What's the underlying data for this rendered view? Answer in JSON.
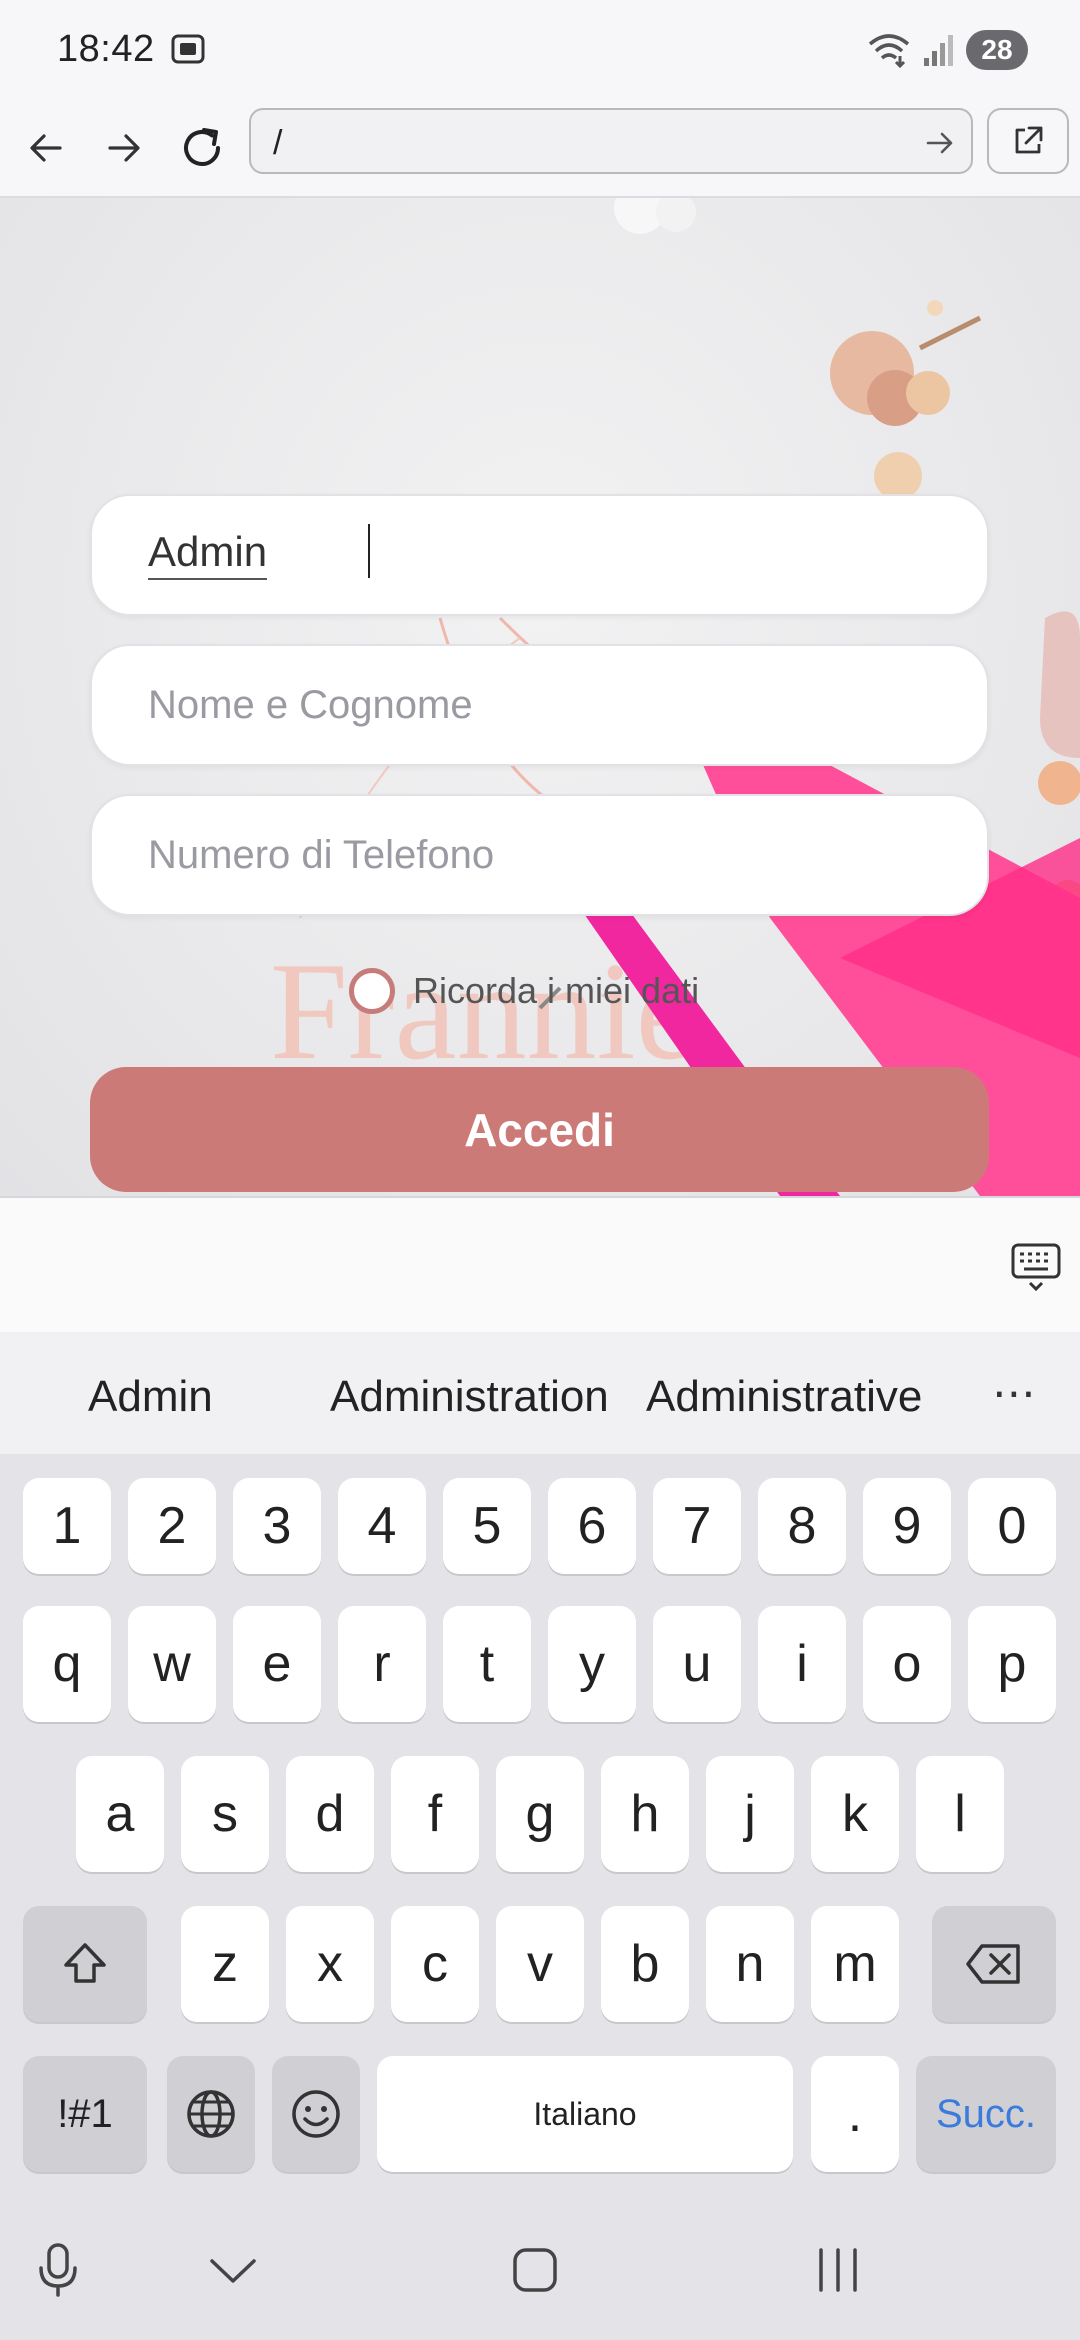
{
  "status": {
    "time": "18:42",
    "battery": "28"
  },
  "browser": {
    "url": "/"
  },
  "form": {
    "username_value": "Admin",
    "name_placeholder": "Nome e Cognome",
    "phone_placeholder": "Numero di Telefono",
    "remember_label": "Ricorda i miei dati",
    "submit_label": "Accedi"
  },
  "keyboard": {
    "suggestions": [
      "Admin",
      "Administration",
      "Administrative"
    ],
    "more": "⋯",
    "row_numbers": [
      "1",
      "2",
      "3",
      "4",
      "5",
      "6",
      "7",
      "8",
      "9",
      "0"
    ],
    "row1": [
      "q",
      "w",
      "e",
      "r",
      "t",
      "y",
      "u",
      "i",
      "o",
      "p"
    ],
    "row2": [
      "a",
      "s",
      "d",
      "f",
      "g",
      "h",
      "j",
      "k",
      "l"
    ],
    "row3": [
      "z",
      "x",
      "c",
      "v",
      "b",
      "n",
      "m"
    ],
    "symbols_label": "!#1",
    "space_label": "Italiano",
    "period_label": ".",
    "enter_label": "Succ."
  },
  "colors": {
    "accent": "#cc7a78",
    "enter_text": "#3a7bdc"
  }
}
